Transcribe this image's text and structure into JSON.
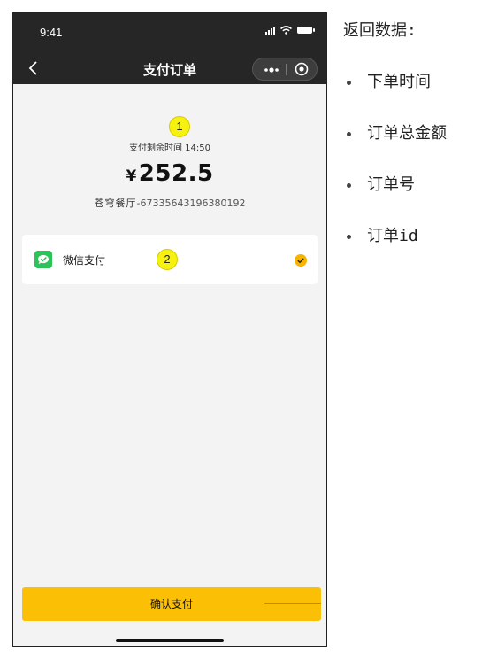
{
  "status_bar": {
    "time": "9:41"
  },
  "nav": {
    "title": "支付订单"
  },
  "order": {
    "remaining_label": "支付剩余时间",
    "remaining_time": "14:50",
    "currency_symbol": "¥",
    "amount": "252.5",
    "shop_name": "苍穹餐厅",
    "order_number": "-67335643196380192"
  },
  "markers": {
    "first": "1",
    "second": "2"
  },
  "payment": {
    "method_label": "微信支付",
    "selected": true
  },
  "confirm_button": {
    "label": "确认支付"
  },
  "notes": {
    "title": "返回数据:",
    "items": [
      "下单时间",
      "订单总金额",
      "订单号",
      "订单id"
    ]
  },
  "colors": {
    "header_bg": "#262626",
    "page_bg": "#f3f3f3",
    "accent_yellow": "#fbbf05",
    "wechat_green": "#2ec35a",
    "marker_yellow": "#f6f10e"
  },
  "icons": {
    "back": "chevron-left-icon",
    "more": "more-dots-icon",
    "close": "target-close-icon",
    "wechat": "wechat-pay-icon",
    "check": "check-circle-icon"
  }
}
